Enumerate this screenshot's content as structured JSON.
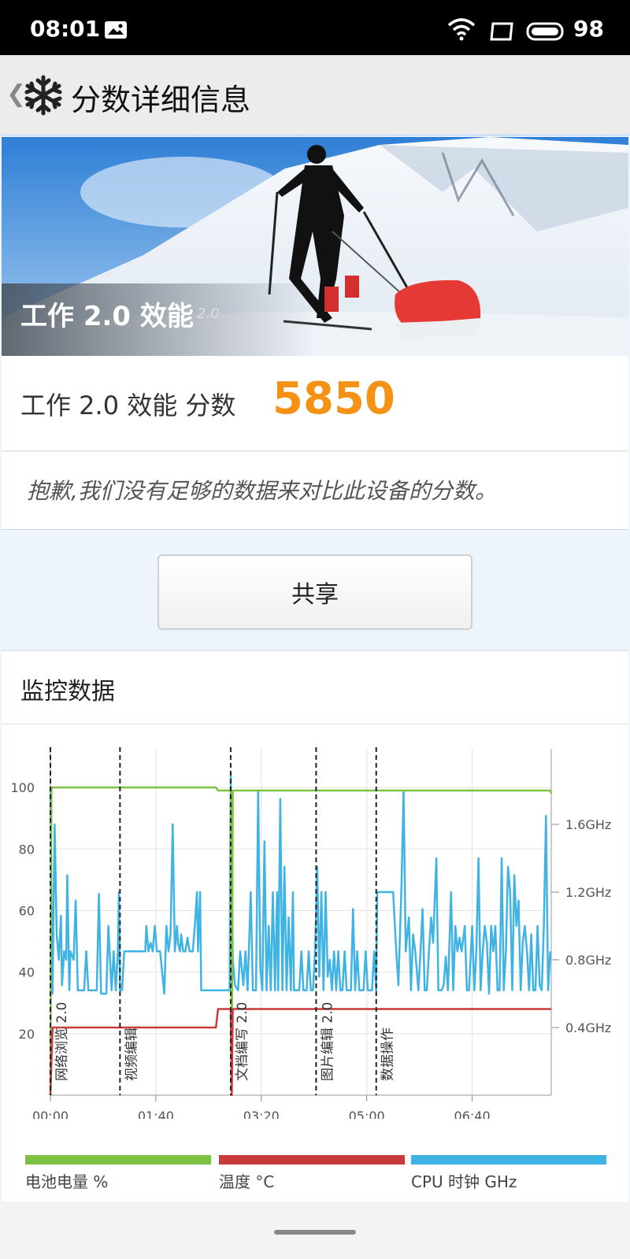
{
  "status_bar": {
    "time": "08:01",
    "battery": "98"
  },
  "header": {
    "title": "分数详细信息"
  },
  "hero": {
    "title": "工作 2.0 效能",
    "version": "2.0"
  },
  "score": {
    "label": "工作 2.0 效能 分数",
    "value": "5850"
  },
  "note": {
    "text": "抱歉,我们没有足够的数据来对比此设备的分数。"
  },
  "share": {
    "label": "共享"
  },
  "monitor": {
    "title": "监控数据"
  },
  "colors": {
    "battery": "#7cc142",
    "temperature": "#c93a3a",
    "cpu": "#3fb3e4",
    "score": "#f39214"
  },
  "chart_data": {
    "type": "line",
    "x_ticks": [
      "00:00",
      "01:40",
      "03:20",
      "05:00",
      "06:40"
    ],
    "y_left_ticks": [
      "20",
      "40",
      "60",
      "80",
      "100"
    ],
    "y_right_ticks": [
      "0.4GHz",
      "0.8GHz",
      "1.2GHz",
      "1.6GHz"
    ],
    "ylim_left": [
      0,
      110
    ],
    "ylim_right": [
      0,
      2.0
    ],
    "xlim_seconds": [
      0,
      475
    ],
    "grid": true,
    "legend_position": "bottom",
    "sections": [
      {
        "label": "网络浏览 2.0",
        "t": 0
      },
      {
        "label": "视频编辑",
        "t": 66
      },
      {
        "label": "文档编写 2.0",
        "t": 171
      },
      {
        "label": "图片编辑 2.0",
        "t": 252
      },
      {
        "label": "数据操作",
        "t": 309
      }
    ],
    "series": [
      {
        "name": "电池电量 %",
        "axis": "left",
        "points": [
          [
            0,
            0
          ],
          [
            1,
            100
          ],
          [
            157,
            100
          ],
          [
            159,
            99
          ],
          [
            171,
            99
          ],
          [
            172,
            0
          ],
          [
            173,
            99
          ],
          [
            474,
            99
          ],
          [
            475,
            98
          ]
        ]
      },
      {
        "name": "温度 °C",
        "axis": "left",
        "points": [
          [
            0,
            0
          ],
          [
            2,
            22
          ],
          [
            157,
            22
          ],
          [
            159,
            28
          ],
          [
            171,
            28
          ],
          [
            172,
            0
          ],
          [
            173,
            28
          ],
          [
            474,
            28
          ],
          [
            475,
            28
          ]
        ]
      },
      {
        "name": "CPU 时钟 GHz",
        "axis": "right",
        "points": [
          [
            0,
            1.8
          ],
          [
            2,
            0.6
          ],
          [
            4,
            1.6
          ],
          [
            6,
            0.95
          ],
          [
            8,
            0.8
          ],
          [
            10,
            1.06
          ],
          [
            11,
            0.65
          ],
          [
            13,
            0.85
          ],
          [
            15,
            0.8
          ],
          [
            16,
            1.3
          ],
          [
            18,
            0.62
          ],
          [
            19,
            0.85
          ],
          [
            22,
            0.8
          ],
          [
            24,
            1.15
          ],
          [
            26,
            0.62
          ],
          [
            32,
            0.62
          ],
          [
            34,
            0.85
          ],
          [
            36,
            0.62
          ],
          [
            38,
            0.62
          ],
          [
            40,
            0.62
          ],
          [
            44,
            0.62
          ],
          [
            46,
            1.19
          ],
          [
            48,
            0.6
          ],
          [
            50,
            0.6
          ],
          [
            53,
            0.6
          ],
          [
            55,
            1.0
          ],
          [
            58,
            0.62
          ],
          [
            60,
            0.85
          ],
          [
            62,
            0.62
          ],
          [
            64,
            0.85
          ],
          [
            65,
            1.2
          ],
          [
            66,
            0.62
          ],
          [
            68,
            0.62
          ],
          [
            70,
            0.85
          ],
          [
            90,
            0.85
          ],
          [
            91,
            1.0
          ],
          [
            93,
            0.85
          ],
          [
            95,
            0.9
          ],
          [
            97,
            0.85
          ],
          [
            99,
            1.0
          ],
          [
            101,
            0.85
          ],
          [
            104,
            0.85
          ],
          [
            108,
            0.6
          ],
          [
            110,
            1.0
          ],
          [
            112,
            0.85
          ],
          [
            114,
            0.95
          ],
          [
            116,
            1.6
          ],
          [
            118,
            0.85
          ],
          [
            120,
            1.0
          ],
          [
            121,
            0.9
          ],
          [
            123,
            0.85
          ],
          [
            124,
            0.95
          ],
          [
            126,
            0.85
          ],
          [
            128,
            0.85
          ],
          [
            130,
            0.93
          ],
          [
            132,
            0.85
          ],
          [
            135,
            0.85
          ],
          [
            137,
            1.0
          ],
          [
            139,
            1.2
          ],
          [
            140,
            0.85
          ],
          [
            142,
            1.2
          ],
          [
            143,
            0.62
          ],
          [
            150,
            0.62
          ],
          [
            155,
            0.62
          ],
          [
            170,
            0.62
          ],
          [
            171,
            1.9
          ],
          [
            173,
            0.8
          ],
          [
            175,
            0.65
          ],
          [
            178,
            0.62
          ],
          [
            180,
            0.85
          ],
          [
            183,
            0.65
          ],
          [
            185,
            0.85
          ],
          [
            187,
            0.62
          ],
          [
            190,
            1.2
          ],
          [
            192,
            0.62
          ],
          [
            195,
            0.62
          ],
          [
            197,
            1.8
          ],
          [
            199,
            0.75
          ],
          [
            201,
            0.62
          ],
          [
            203,
            1.5
          ],
          [
            205,
            0.62
          ],
          [
            207,
            1.0
          ],
          [
            209,
            0.62
          ],
          [
            211,
            1.2
          ],
          [
            213,
            0.62
          ],
          [
            215,
            1.2
          ],
          [
            216,
            0.62
          ],
          [
            218,
            1.75
          ],
          [
            220,
            0.62
          ],
          [
            222,
            1.35
          ],
          [
            224,
            0.62
          ],
          [
            226,
            1.05
          ],
          [
            228,
            0.62
          ],
          [
            230,
            1.2
          ],
          [
            231,
            0.62
          ],
          [
            234,
            0.62
          ],
          [
            236,
            0.62
          ],
          [
            238,
            0.85
          ],
          [
            240,
            0.62
          ],
          [
            243,
            0.62
          ],
          [
            245,
            0.85
          ],
          [
            247,
            0.62
          ],
          [
            249,
            0.62
          ],
          [
            251,
            0.85
          ],
          [
            253,
            1.35
          ],
          [
            255,
            0.7
          ],
          [
            257,
            1.2
          ],
          [
            259,
            0.62
          ],
          [
            261,
            1.2
          ],
          [
            263,
            0.7
          ],
          [
            265,
            0.8
          ],
          [
            267,
            0.62
          ],
          [
            269,
            0.85
          ],
          [
            271,
            0.62
          ],
          [
            273,
            0.85
          ],
          [
            275,
            0.62
          ],
          [
            277,
            0.62
          ],
          [
            279,
            0.85
          ],
          [
            281,
            0.62
          ],
          [
            283,
            0.62
          ],
          [
            285,
            0.62
          ],
          [
            287,
            1.1
          ],
          [
            289,
            0.62
          ],
          [
            291,
            0.85
          ],
          [
            293,
            0.62
          ],
          [
            297,
            0.62
          ],
          [
            299,
            0.85
          ],
          [
            301,
            0.62
          ],
          [
            303,
            0.62
          ],
          [
            305,
            0.62
          ],
          [
            307,
            0.85
          ],
          [
            309,
            0.62
          ],
          [
            310,
            1.2
          ],
          [
            325,
            1.2
          ],
          [
            328,
            0.85
          ],
          [
            330,
            0.65
          ],
          [
            333,
            1.25
          ],
          [
            335,
            1.8
          ],
          [
            337,
            0.85
          ],
          [
            340,
            1.05
          ],
          [
            342,
            0.62
          ],
          [
            344,
            0.95
          ],
          [
            346,
            0.85
          ],
          [
            349,
            0.62
          ],
          [
            351,
            0.85
          ],
          [
            353,
            1.1
          ],
          [
            355,
            0.62
          ],
          [
            357,
            0.62
          ],
          [
            359,
            0.85
          ],
          [
            361,
            1.05
          ],
          [
            363,
            0.9
          ],
          [
            366,
            1.4
          ],
          [
            368,
            0.62
          ],
          [
            371,
            0.62
          ],
          [
            373,
            0.65
          ],
          [
            375,
            0.82
          ],
          [
            377,
            0.62
          ],
          [
            380,
            1.2
          ],
          [
            382,
            0.62
          ],
          [
            384,
            1.0
          ],
          [
            386,
            0.85
          ],
          [
            388,
            0.93
          ],
          [
            390,
            0.85
          ],
          [
            393,
            1.0
          ],
          [
            395,
            0.62
          ],
          [
            397,
            0.62
          ],
          [
            400,
            1.0
          ],
          [
            402,
            0.62
          ],
          [
            404,
            0.85
          ],
          [
            406,
            1.4
          ],
          [
            408,
            0.62
          ],
          [
            410,
            0.85
          ],
          [
            412,
            1.0
          ],
          [
            414,
            0.9
          ],
          [
            416,
            0.6
          ],
          [
            418,
            1.0
          ],
          [
            420,
            0.85
          ],
          [
            422,
            1.0
          ],
          [
            424,
            0.62
          ],
          [
            426,
            0.62
          ],
          [
            428,
            1.4
          ],
          [
            430,
            0.62
          ],
          [
            432,
            0.85
          ],
          [
            434,
            1.35
          ],
          [
            436,
            1.2
          ],
          [
            438,
            0.62
          ],
          [
            440,
            1.3
          ],
          [
            442,
            1.0
          ],
          [
            444,
            1.15
          ],
          [
            446,
            0.62
          ],
          [
            448,
            0.9
          ],
          [
            450,
            1.0
          ],
          [
            452,
            0.85
          ],
          [
            454,
            0.62
          ],
          [
            456,
            0.95
          ],
          [
            458,
            0.62
          ],
          [
            460,
            0.62
          ],
          [
            462,
            1.0
          ],
          [
            464,
            0.65
          ],
          [
            466,
            0.62
          ],
          [
            468,
            1.0
          ],
          [
            470,
            1.65
          ],
          [
            472,
            0.62
          ],
          [
            474,
            0.85
          ]
        ]
      }
    ]
  }
}
